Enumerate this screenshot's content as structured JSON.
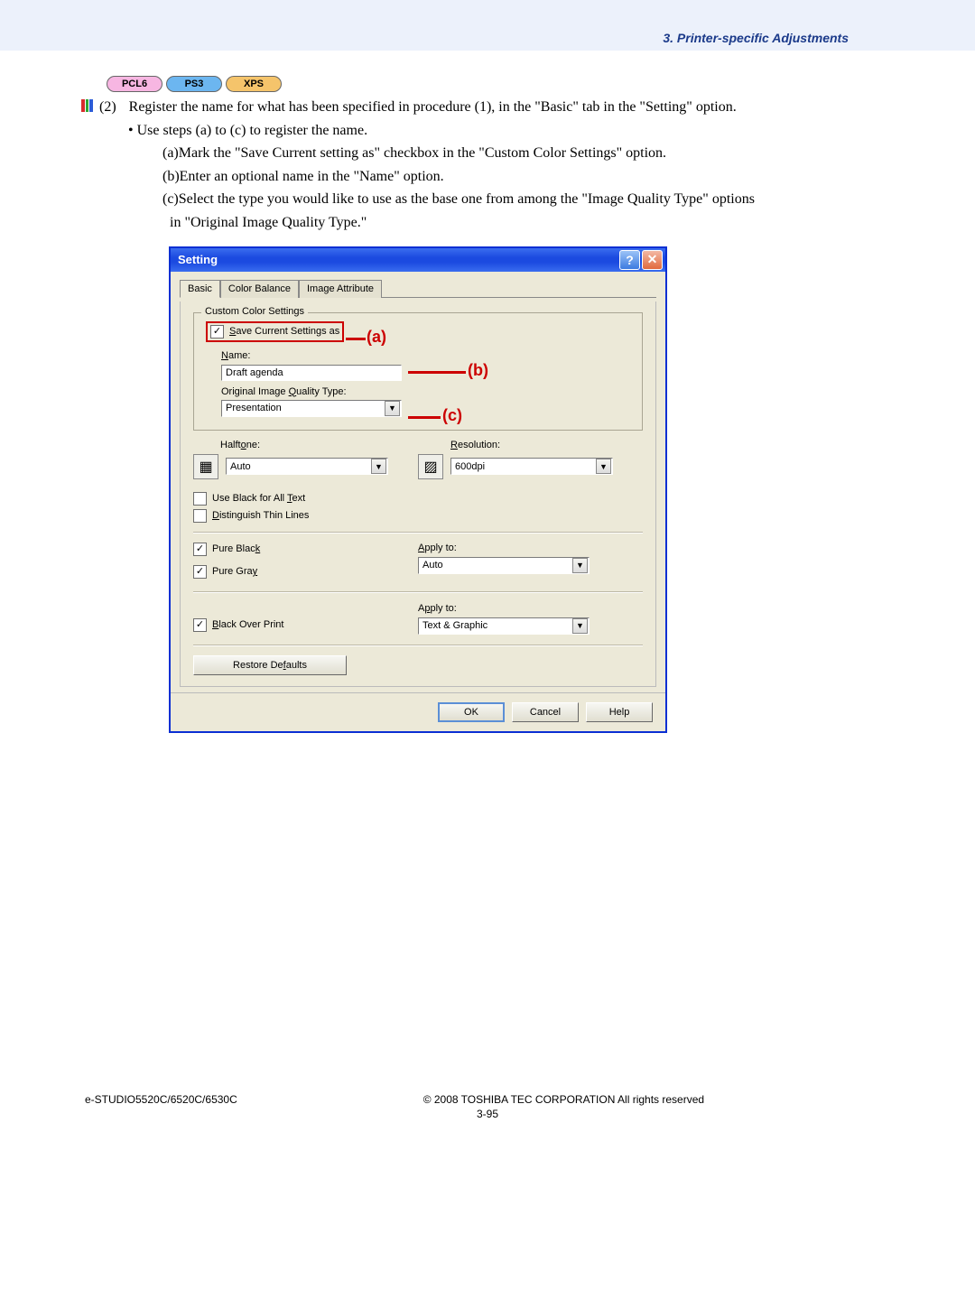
{
  "header": {
    "section_title": "3. Printer-specific Adjustments"
  },
  "badges": {
    "pcl6": "PCL6",
    "ps3": "PS3",
    "xps": "XPS"
  },
  "step": {
    "num": "(2)",
    "text": "Register the name for what has been specified in procedure (1), in the \"Basic\" tab in the \"Setting\" option.",
    "bullet": "• Use steps (a) to (c) to register the name.",
    "a": "(a)Mark the \"Save Current setting as\" checkbox in the \"Custom Color Settings\" option.",
    "b": "(b)Enter an optional name in the \"Name\" option.",
    "c1": "(c)Select the type you would like to use as the base one from among the \"Image Quality Type\" options",
    "c2": "in \"Original Image Quality Type.\""
  },
  "dialog": {
    "title": "Setting",
    "tabs": {
      "basic": "Basic",
      "color_balance": "Color Balance",
      "image_attribute": "Image Attribute"
    },
    "groupbox_label": "Custom Color Settings",
    "save_as_label": "Save Current Settings as",
    "name_label": "Name:",
    "name_value": "Draft agenda",
    "oiqt_label": "Original Image Quality Type:",
    "oiqt_value": "Presentation",
    "halftone_label": "Halftone:",
    "halftone_value": "Auto",
    "resolution_label": "Resolution:",
    "resolution_value": "600dpi",
    "use_black_text": "Use Black for All Text",
    "distinguish_thin": "Distinguish Thin Lines",
    "pure_black": "Pure Black",
    "pure_gray": "Pure Gray",
    "apply_to": "Apply to:",
    "apply1_value": "Auto",
    "black_overprint": "Black Over Print",
    "apply2_value": "Text & Graphic",
    "restore_defaults": "Restore Defaults",
    "ok": "OK",
    "cancel": "Cancel",
    "help": "Help"
  },
  "callouts": {
    "a": "(a)",
    "b": "(b)",
    "c": "(c)"
  },
  "footer": {
    "left": "e-STUDIO5520C/6520C/6530C",
    "center": "3-95",
    "right": "© 2008 TOSHIBA TEC CORPORATION All rights reserved"
  }
}
